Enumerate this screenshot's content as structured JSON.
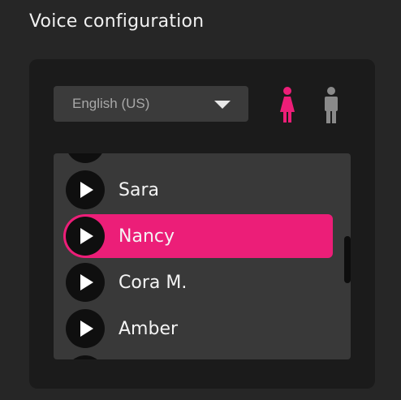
{
  "header": {
    "title": "Voice configuration"
  },
  "language_select": {
    "value": "English (US)"
  },
  "colors": {
    "accent": "#ec1e78",
    "inactive_icon": "#8a8a8a",
    "panel": "#1b1b1b",
    "list_bg": "#393939"
  },
  "gender_filter": {
    "icons": [
      "female-icon",
      "male-icon"
    ],
    "selected": "female"
  },
  "voices": [
    {
      "name": "Sara",
      "selected": false
    },
    {
      "name": "Nancy",
      "selected": true
    },
    {
      "name": "Cora M.",
      "selected": false
    },
    {
      "name": "Amber",
      "selected": false
    }
  ]
}
